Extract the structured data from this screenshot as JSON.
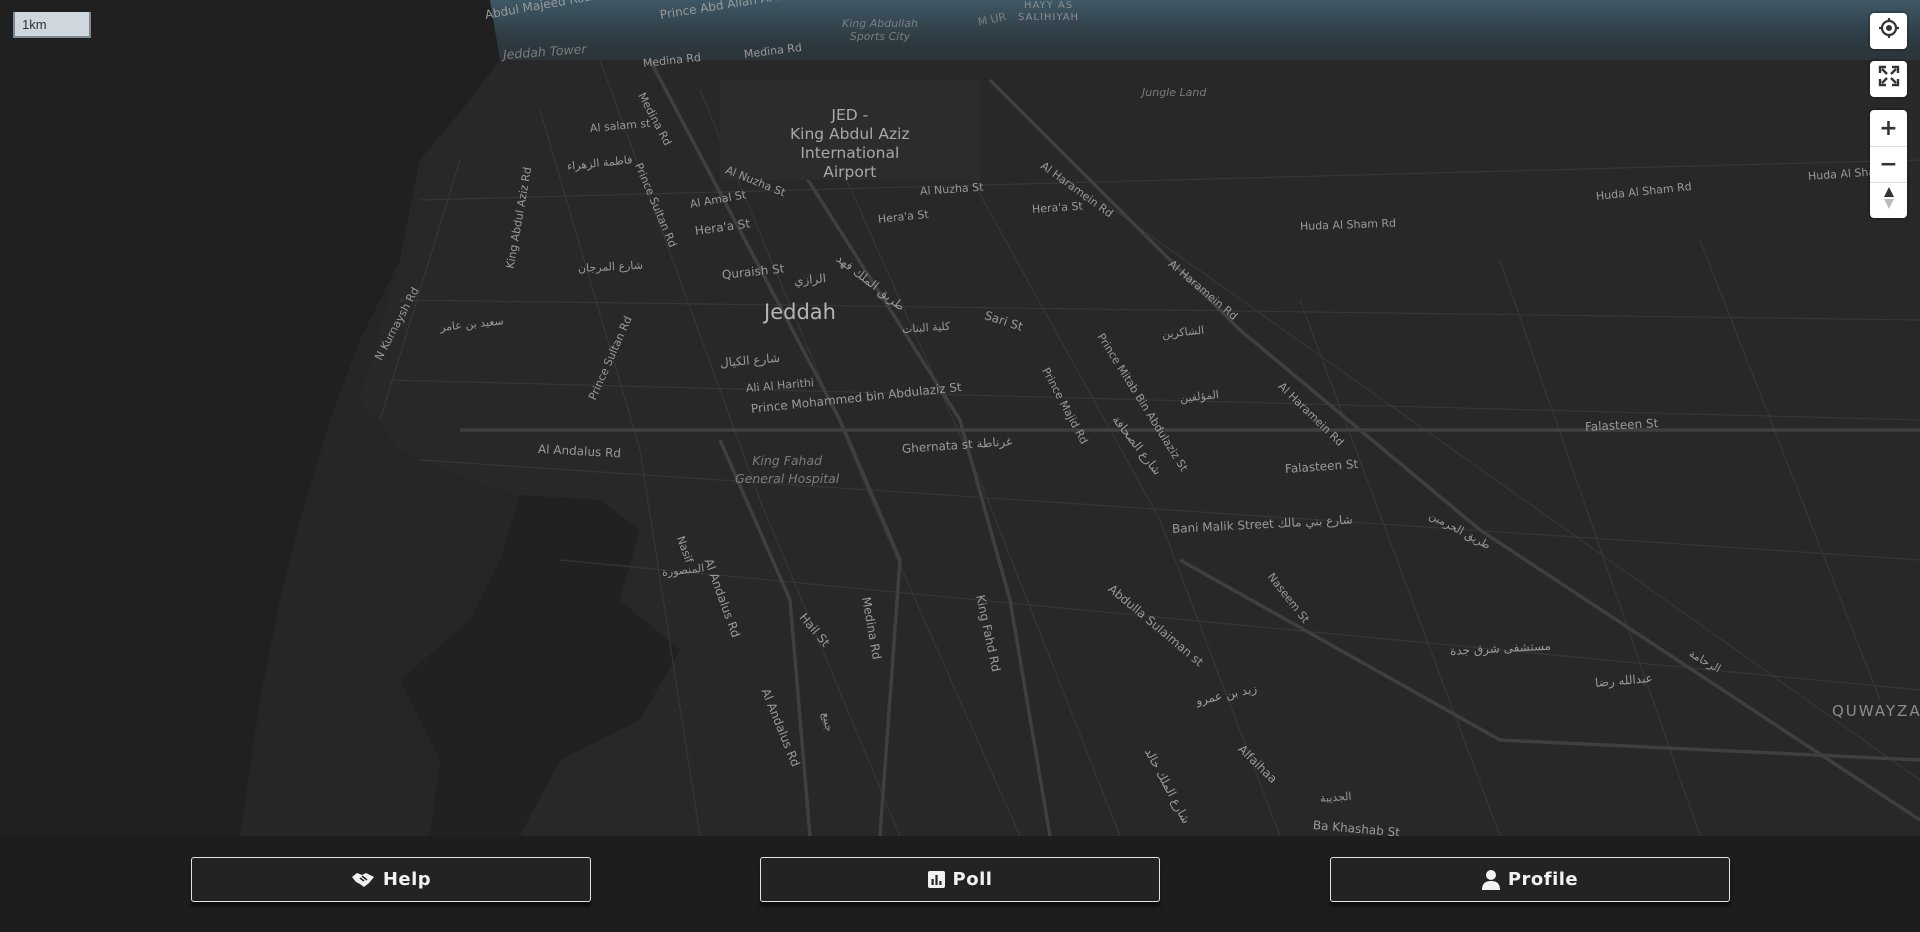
{
  "map": {
    "scale_label": "1km",
    "labels": {
      "city": "Jeddah",
      "airport": "JED -\nKing Abdul Aziz\nInternational\nAirport",
      "poi": {
        "jeddah_tower": "Jeddah Tower",
        "sports_city": "King Abdullah\nSports City",
        "jungle_land": "Jungle Land",
        "hospital": "King Fahad\nGeneral Hospital"
      },
      "areas": {
        "hayy_as_salihiyah": "HAYY AS\nSALIHIYAH",
        "quwayza": "QUWAYZA",
        "m_ur": "M UR"
      },
      "streets": [
        "Abdul Majeed Road طريق عبد المجيد",
        "Prince Abd Allah Al Faisal St",
        "Medina Rd",
        "Medina Rd",
        "Medina Rd",
        "Al salam st",
        "فاطمة الزهراء",
        "Prince Sultan Rd",
        "Al Nuzha St",
        "Al Nuzha St",
        "Al Amal St",
        "Hera'a St",
        "Hera'a St",
        "Hera'a St",
        "Al Haramein Rd",
        "Al Haramein Rd",
        "Al Haramein Rd",
        "Huda Al Sham Rd",
        "Huda Al Sham Rd",
        "Huda Al Sham Rd",
        "King Abdul Aziz Rd",
        "شارع المرجان",
        "N Kurnaysh Rd",
        "سعيد بن عامر",
        "Quraish St",
        "الرازي",
        "طريق الملك فهد",
        "كلية البنات",
        "Sari St",
        "الشاكرين",
        "Prince Mitab Bin Abdulaziz St",
        "شارع الكيال",
        "Ali Al Harithi",
        "Prince Mohammed bin Abdulaziz St",
        "Prince Sultan Rd",
        "Prince Majid Rd",
        "شارع الصحافة",
        "المؤلفين",
        "Falasteen St",
        "Falasteen St",
        "Al Andalus Rd",
        "Ghernata st غرناطة",
        "Bani Malik Street شارع بني مالك",
        "طريق الحرمين",
        "Nasif",
        "المنصورة",
        "Al Andalus Rd",
        "Hail St",
        "Medina Rd",
        "King Fahd Rd",
        "Naseem St",
        "Abdulla Sulaiman st",
        "مستشفى شرق جدة",
        "عبدالله رضا",
        "الرحامة",
        "Al Andalus Rd",
        "زيد بن عمرو",
        "Alfaihaa",
        "شارع الملك خالد",
        "الجديبة",
        "Ba Khashab St",
        "جبيع"
      ]
    },
    "controls": {
      "locate_icon": "locate-icon",
      "fullscreen_icon": "fullscreen-icon",
      "zoom_in": "+",
      "zoom_out": "−",
      "compass_icon": "compass-icon"
    }
  },
  "nav": {
    "help": {
      "label": "Help",
      "icon": "handshake-icon"
    },
    "poll": {
      "label": "Poll",
      "icon": "poll-icon"
    },
    "profile": {
      "label": "Profile",
      "icon": "user-icon"
    }
  },
  "colors": {
    "map_background": "#262626",
    "sky": "#3e5866",
    "roads": "#3a3a3a",
    "bar_background": "#1d1d1d",
    "button_border": "#e4e4e4"
  }
}
